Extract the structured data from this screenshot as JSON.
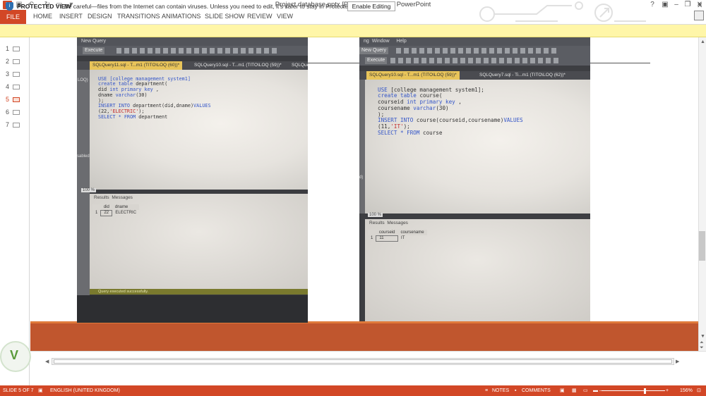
{
  "window": {
    "title": "Project database.pptx [Protected View] - PowerPoint",
    "app_icon": "P",
    "quick_access": [
      "save-icon",
      "undo-icon",
      "redo-icon",
      "start-slideshow-icon",
      "customize-icon"
    ],
    "controls": {
      "help": "?",
      "minimize": "–",
      "restore": "❐",
      "close": "✕"
    }
  },
  "ribbon": {
    "file_label": "FILE",
    "tabs": [
      "HOME",
      "INSERT",
      "DESIGN",
      "TRANSITIONS",
      "ANIMATIONS",
      "SLIDE SHOW",
      "REVIEW",
      "VIEW"
    ]
  },
  "protected_view": {
    "title": "PROTECTED VIEW",
    "message": "Be careful—files from the Internet can contain viruses. Unless you need to edit, it's safer to stay in Protected View.",
    "button": "Enable Editing",
    "close": "✕"
  },
  "thumbnails": {
    "numbers": [
      "1",
      "2",
      "3",
      "4",
      "5",
      "6",
      "7"
    ],
    "active_index": 5
  },
  "photo_left": {
    "menu": "New Query",
    "execute": "Execute",
    "tab_active": "SQLQuery11.sql - T...m1 (TITO\\LOQ (60))*",
    "tab_other": "SQLQuery10.sql - T...m1 (TITO\\LOQ (59))*",
    "tab_other2": "SQLQue",
    "gutter_text": "LOQ)",
    "gutter_text2": "sabled)",
    "code": {
      "l1": "USE [college management system1]",
      "l2a": "create table",
      "l2b": " department(",
      "l3a": "did ",
      "l3b": "int primary key",
      "l3c": " ,",
      "l4a": "dname ",
      "l4b": "varchar",
      "l4c": "(30)",
      "l5": ");",
      "l6a": "INSERT INTO",
      "l6b": " department(did,dname)",
      "l6c": "VALUES",
      "l7a": "(22,",
      "l7b": "'ELECTRIC'",
      "l7c": ");",
      "l8a": "SELECT * FROM",
      "l8b": " department"
    },
    "zoom": "100 %",
    "results_tab": "Results",
    "messages_tab": "Messages",
    "columns": [
      "did",
      "dname"
    ],
    "row": [
      "1",
      "22",
      "ELECTRIC"
    ],
    "status": "Query executed successfully."
  },
  "photo_right": {
    "menu_a": "ng",
    "menu_b": "Window",
    "menu_c": "Help",
    "new_query": "New Query",
    "execute": "Execute",
    "tab_active": "SQLQuery10.sql - T...m1 (TITO\\LOQ (59))*",
    "tab_other": "SQLQuery7.sql - Ti...m1 (TITO\\LOQ (62))*",
    "gutter_text": "d)",
    "code": {
      "l1a": "USE",
      "l1b": " [college management system1];",
      "l2a": "create table",
      "l2b": " course(",
      "l3a": "courseid ",
      "l3b": "int primary key",
      "l3c": " ,",
      "l4a": "coursename ",
      "l4b": "varchar",
      "l4c": "(30)",
      "l5": ");",
      "l6a": "INSERT INTO",
      "l6b": " course(courseid,coursename)",
      "l6c": "VALUES",
      "l7a": "(11,",
      "l7b": "'IT'",
      "l7c": ");",
      "l8a": "SELECT * FROM",
      "l8b": " course"
    },
    "zoom": "100 %",
    "results_tab": "Results",
    "messages_tab": "Messages",
    "columns": [
      "courseid",
      "coursename"
    ],
    "row": [
      "1",
      "11",
      "IT"
    ]
  },
  "statusbar": {
    "slide": "SLIDE 5 OF 7",
    "language": "ENGLISH (UNITED KINGDOM)",
    "notes": "NOTES",
    "comments": "COMMENTS",
    "zoom": "156%"
  }
}
